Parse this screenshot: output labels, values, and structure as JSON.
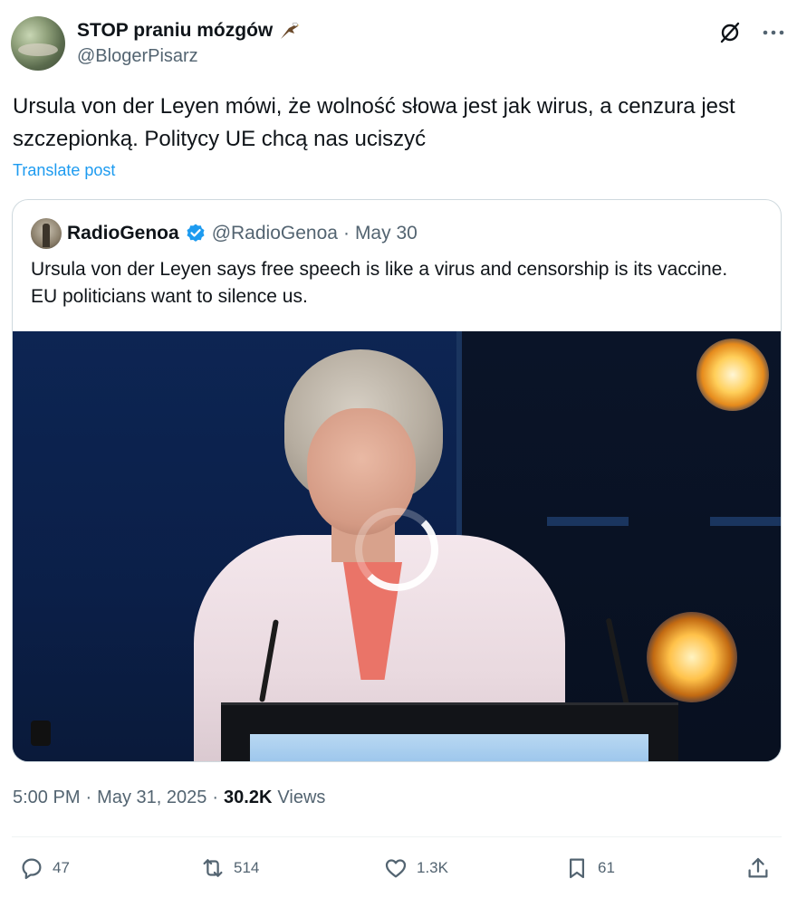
{
  "author": {
    "display_name": "STOP praniu mózgów",
    "handle": "@BlogerPisarz",
    "avatar": "landscape-avatar",
    "emoji": "eagle-icon"
  },
  "tweet": {
    "text": "Ursula von der Leyen mówi, że wolność słowa jest jak wirus, a cenzura jest szczepionką. Politycy UE chcą nas uciszyć",
    "translate_label": "Translate post"
  },
  "quote": {
    "name": "RadioGenoa",
    "handle": "@RadioGenoa",
    "separator": "·",
    "date": "May 30",
    "text": "Ursula von der Leyen says free speech is like a virus and censorship is its vaccine. EU politicians want to silence us.",
    "media": "video-thumbnail"
  },
  "meta": {
    "time": "5:00 PM",
    "separator": "·",
    "date": "May 31, 2025",
    "separator2": "·",
    "views_count": "30.2K",
    "views_label": "Views"
  },
  "actions": {
    "replies": "47",
    "reposts": "514",
    "likes": "1.3K",
    "bookmarks": "61"
  },
  "colors": {
    "accent": "#1d9bf0",
    "text": "#0f1419",
    "muted": "#536471",
    "border": "#cfd9de"
  }
}
